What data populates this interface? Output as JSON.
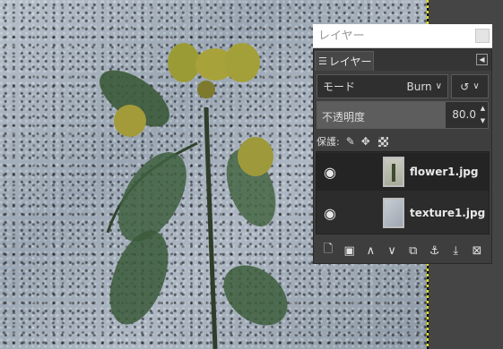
{
  "dock": {
    "title": "レイヤー",
    "tab_label": "レイヤー",
    "mode_label": "モード",
    "mode_value": "Burn",
    "opacity_label": "不透明度",
    "opacity_value": "80.0",
    "opacity_fraction": 0.8,
    "lock_label": "保護:"
  },
  "layers": [
    {
      "name": "flower1.jpg",
      "selected": true,
      "visible": true
    },
    {
      "name": "texture1.jpg",
      "selected": false,
      "visible": true
    }
  ],
  "icons": {
    "eye": "eye-icon",
    "lock_pixels": "paintbrush-icon",
    "lock_position": "move-arrows-icon",
    "lock_alpha": "checkerboard-icon",
    "new_layer": "new-layer-icon",
    "new_group": "new-layer-group-icon",
    "raise": "chevron-up-icon",
    "lower": "chevron-down-icon",
    "duplicate": "duplicate-icon",
    "anchor": "anchor-icon",
    "merge": "merge-down-icon",
    "delete": "delete-icon"
  },
  "colors": {
    "canvas_bg": "#a4afbb",
    "dock_bg": "#3e3e3e",
    "selected_row": "#242424",
    "canvas_border": "#e6e600"
  }
}
